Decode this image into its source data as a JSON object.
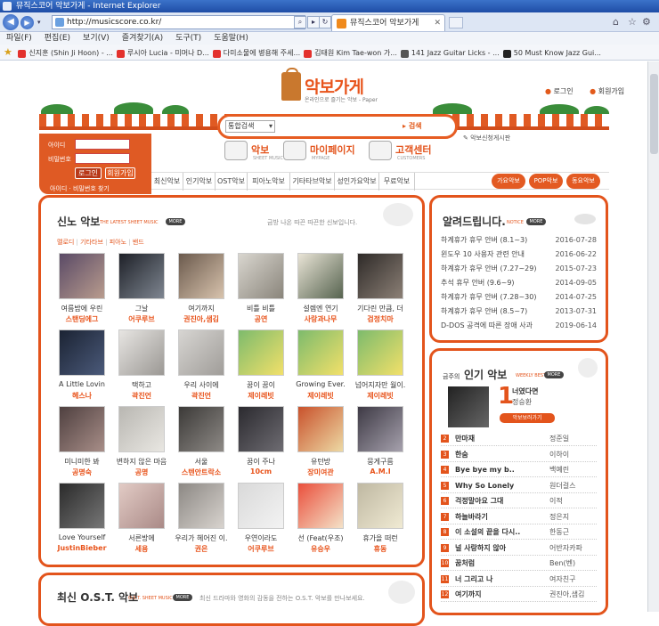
{
  "browser": {
    "title": "뮤직스코어 악보가게 - Internet Explorer",
    "url": "http://musicscore.co.kr/",
    "tab_title": "뮤직스코어 악보가게",
    "menu": [
      "파일(F)",
      "편집(E)",
      "보기(V)",
      "즐겨찾기(A)",
      "도구(T)",
      "도움말(H)"
    ],
    "favorites": [
      {
        "label": "신지훈 (Shin Ji Hoon) - ...",
        "color": "#e3312d"
      },
      {
        "label": "루시아 Lucia - 미머나 D...",
        "color": "#e3312d"
      },
      {
        "label": "다미소물에 병용해 주세...",
        "color": "#e3312d"
      },
      {
        "label": "김태원 Kim Tae-won 가...",
        "color": "#e3312d"
      },
      {
        "label": "141 Jazz Guitar Licks - ...",
        "color": "#555555"
      },
      {
        "label": "50 Must Know Jazz Gui...",
        "color": "#222222"
      }
    ]
  },
  "site": {
    "logo_title": "악보가게",
    "logo_sub": "온라인으로 즐기는 악보 - Paper",
    "top_links": [
      "로그인",
      "회원가입"
    ],
    "search_select": "통합검색",
    "search_button": "검색",
    "notice_link": "악보신청게시판",
    "login": {
      "id_label": "아이디",
      "pw_label": "비밀번호",
      "login_btn": "로그인",
      "join_btn": "회원가입",
      "find": "아이디 · 비밀번호 찾기"
    },
    "main_menu": [
      {
        "title": "악보",
        "sub": "SHEET MUSIC"
      },
      {
        "title": "마이페이지",
        "sub": "MYPAGE"
      },
      {
        "title": "고객센터",
        "sub": "CUSTOMERS"
      }
    ],
    "categories": [
      "최신악보",
      "인기악보",
      "OST악보",
      "피아노악보",
      "기타타브악보",
      "성인가요악보",
      "무료악보"
    ],
    "category_pills": [
      "가요악보",
      "POP악보",
      "동요악보"
    ],
    "accent": "#e3541c"
  },
  "new_sheets": {
    "title": "신노 악보",
    "sub": "THE LATEST SHEET MUSIC",
    "more": "MORE",
    "desc": "금방 나온 따끈 따끈한 신보입니다.",
    "filters": [
      "멜로디",
      "기타타브",
      "피아노",
      "밴드"
    ],
    "items": [
      {
        "title": "여름밤에 우린",
        "artist": "스탠딩에그",
        "c1": "#5a4a66",
        "c2": "#b99c8e"
      },
      {
        "title": "그날",
        "artist": "어쿠루브",
        "c1": "#1e2128",
        "c2": "#7f8691"
      },
      {
        "title": "여기까지",
        "artist": "권진아,샘김",
        "c1": "#6b5a4d",
        "c2": "#d8c3ad"
      },
      {
        "title": "비틀 비틀",
        "artist": "공연",
        "c1": "#d9d6cf",
        "c2": "#8a857b"
      },
      {
        "title": "설렘엔 연기",
        "artist": "사랑과나무",
        "c1": "#e9e4d6",
        "c2": "#56634f"
      },
      {
        "title": "기다린 만큼, 더",
        "artist": "검정치마",
        "c1": "#2e2a28",
        "c2": "#8c8076"
      },
      {
        "title": "A Little Lovin",
        "artist": "헤스나",
        "c1": "#1b2333",
        "c2": "#4b5a7a"
      },
      {
        "title": "택하고",
        "artist": "곽진언",
        "c1": "#e7e5e2",
        "c2": "#9b9894"
      },
      {
        "title": "우리 사이에",
        "artist": "곽진언",
        "c1": "#d7d5d2",
        "c2": "#a09d99"
      },
      {
        "title": "꿈이 꿈이",
        "artist": "제이레빗",
        "c1": "#7dbb6c",
        "c2": "#f2e06a"
      },
      {
        "title": "Growing Ever.",
        "artist": "제이레빗",
        "c1": "#7dbb6c",
        "c2": "#f2e06a"
      },
      {
        "title": "넘어지자만 월이.",
        "artist": "제이레빗",
        "c1": "#7dbb6c",
        "c2": "#f2e06a"
      },
      {
        "title": "미니미한 봐",
        "artist": "공명숙",
        "c1": "#4f4040",
        "c2": "#a88e88"
      },
      {
        "title": "변하지 않은 마음",
        "artist": "공명",
        "c1": "#b9b7b2",
        "c2": "#e9e7e2"
      },
      {
        "title": "서울",
        "artist": "스텐안트락소",
        "c1": "#3c3a38",
        "c2": "#8e8a86"
      },
      {
        "title": "꿈이 주나",
        "artist": "10cm",
        "c1": "#2b2a2f",
        "c2": "#6e6c72"
      },
      {
        "title": "유턴방",
        "artist": "장미여관",
        "c1": "#c9522c",
        "c2": "#edd9a4"
      },
      {
        "title": "뭉게구름",
        "artist": "A.M.I",
        "c1": "#3e3a45",
        "c2": "#a6a1ad"
      },
      {
        "title": "Love Yourself",
        "artist": "JustinBieber",
        "c1": "#2a2a2a",
        "c2": "#777777"
      },
      {
        "title": "서른방에",
        "artist": "세용",
        "c1": "#e2cbc5",
        "c2": "#aa8a87"
      },
      {
        "title": "우리가 헤어진 이.",
        "artist": "권은",
        "c1": "#8c8884",
        "c2": "#d8d3ce"
      },
      {
        "title": "우연이라도",
        "artist": "어쿠루브",
        "c1": "#d9d9d9",
        "c2": "#f3f3f3"
      },
      {
        "title": "선 (Feat(우조)",
        "artist": "유승우",
        "c1": "#ea4f3c",
        "c2": "#f4e2c8"
      },
      {
        "title": "휴가을 떠런",
        "artist": "휴동",
        "c1": "#bfb8a2",
        "c2": "#f0ead3"
      }
    ]
  },
  "notices": {
    "title": "알려드립니다.",
    "sub": "NOTICE",
    "more": "MORE",
    "items": [
      {
        "title": "하계휴가 휴무 안버 (8.1~3)",
        "date": "2016-07-28"
      },
      {
        "title": "윈도우 10 사용자 관련 안내",
        "date": "2016-06-22"
      },
      {
        "title": "하계휴가 휴무 안버 (7.27~29)",
        "date": "2015-07-23"
      },
      {
        "title": "추석 휴무 안버 (9.6~9)",
        "date": "2014-09-05"
      },
      {
        "title": "하계휴가 휴무 안버 (7.28~30)",
        "date": "2014-07-25"
      },
      {
        "title": "하계휴가 휴무 안버 (8.5~7)",
        "date": "2013-07-31"
      },
      {
        "title": "D-DOS 공격에 따른 장애 사과",
        "date": "2019-06-14"
      }
    ]
  },
  "popular": {
    "label_pre": "금주의",
    "title": "인기 악보",
    "sub": "WEEKLY BEST",
    "more": "MORE",
    "top_rank": "1",
    "top_title": "너였다면",
    "top_artist": "정승환",
    "top_button": "악보보러가기",
    "items": [
      {
        "rank": "2",
        "title": "만마재",
        "artist": "정준일"
      },
      {
        "rank": "3",
        "title": "한숨",
        "artist": "이하이"
      },
      {
        "rank": "4",
        "title": "Bye bye my b..",
        "artist": "백예린"
      },
      {
        "rank": "5",
        "title": "Why So Lonely",
        "artist": "원더걸스"
      },
      {
        "rank": "6",
        "title": "걱정말아요 그대",
        "artist": "이적"
      },
      {
        "rank": "7",
        "title": "하늘바라기",
        "artist": "정은지"
      },
      {
        "rank": "8",
        "title": "이 소설의 끝을 다시..",
        "artist": "한동근"
      },
      {
        "rank": "9",
        "title": "널 사랑하지 않아",
        "artist": "어반자카파"
      },
      {
        "rank": "10",
        "title": "꿈처럼",
        "artist": "Ben(벤)"
      },
      {
        "rank": "11",
        "title": "너 그리고 나",
        "artist": "여자친구"
      },
      {
        "rank": "12",
        "title": "여기까지",
        "artist": "권진아,샘김"
      }
    ]
  },
  "ost": {
    "title": "최신 O.S.T. 악보",
    "sub": "O.S.T. SHEET MUSIC",
    "more": "MORE",
    "desc": "최신 드라마와 영화의 감동을 전하는 O.S.T. 악보를 만나보세요."
  }
}
